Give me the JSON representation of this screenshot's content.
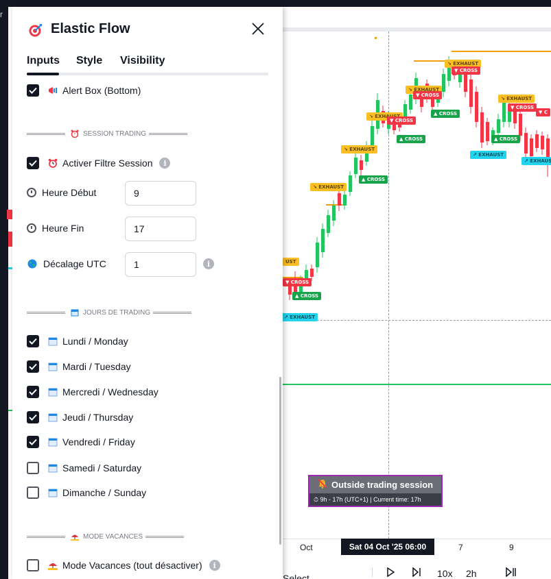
{
  "window": {
    "left_edge_text": "r"
  },
  "dialog": {
    "title": "Elastic Flow",
    "title_icon": "target-icon",
    "tabs": [
      {
        "label": "Inputs",
        "active": true
      },
      {
        "label": "Style",
        "active": false
      },
      {
        "label": "Visibility",
        "active": false
      }
    ],
    "alert_box": {
      "label": "Alert Box (Bottom)",
      "checked": true,
      "icon": "megaphone-icon"
    },
    "session_section": {
      "label": "SESSION TRADING",
      "icon": "alarm-clock-icon"
    },
    "activer_filtre": {
      "label": "Activer Filtre Session",
      "checked": true,
      "icon": "alarm-clock-icon"
    },
    "heure_debut": {
      "label": "Heure Début",
      "value": "9",
      "icon": "clock-icon"
    },
    "heure_fin": {
      "label": "Heure Fin",
      "value": "17",
      "icon": "clock-icon"
    },
    "decalage_utc": {
      "label": "Décalage UTC",
      "value": "1",
      "icon": "globe-icon"
    },
    "jours_section": {
      "label": "JOURS DE TRADING",
      "icon": "calendar-icon"
    },
    "days": [
      {
        "label": "Lundi / Monday",
        "checked": true
      },
      {
        "label": "Mardi / Tuesday",
        "checked": true
      },
      {
        "label": "Mercredi / Wednesday",
        "checked": true
      },
      {
        "label": "Jeudi / Thursday",
        "checked": true
      },
      {
        "label": "Vendredi / Friday",
        "checked": true
      },
      {
        "label": "Samedi / Saturday",
        "checked": false
      },
      {
        "label": "Dimanche / Sunday",
        "checked": false
      }
    ],
    "vacances_section": {
      "label": "MODE VACANCES",
      "icon": "beach-icon"
    },
    "mode_vacances": {
      "label": "Mode Vacances (tout désactiver)",
      "checked": false,
      "icon": "beach-icon"
    }
  },
  "chart": {
    "tags": {
      "exhaust": "↘ EXHAUST",
      "exhaust_up": "↗ EXHAUST",
      "cross_down": "▼ CROSS",
      "cross_up": "▲ CROSS",
      "partial_exhaust": "UST",
      "partial_cross": "▼ C"
    },
    "session_banner": {
      "title": "Outside trading session",
      "subtitle": "⏱ 9h - 17h (UTC+1) | Current time: 17h"
    },
    "time_axis": {
      "oct": "Oct",
      "active": "Sat 04 Oct '25   06:00",
      "seven": "7",
      "nine": "9"
    },
    "toolbar": {
      "select_bar": "Select bar",
      "speed": "10x",
      "interval": "2h"
    },
    "colors": {
      "up": "#22c55e",
      "down": "#f23645",
      "exhaust": "#fbbf24",
      "exhaust_alt": "#22d3ee",
      "banner_border": "#9c27b0"
    }
  }
}
